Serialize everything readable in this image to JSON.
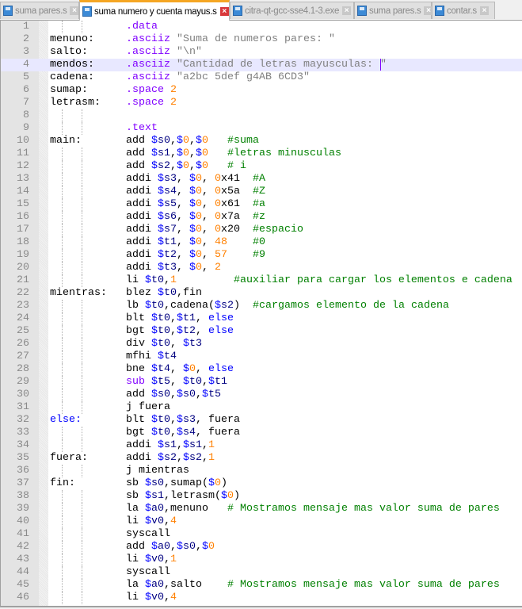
{
  "tabs": [
    {
      "label": "suma pares.s",
      "active": false
    },
    {
      "label": "suma numero y cuenta mayus.s",
      "active": true
    },
    {
      "label": "citra-qt-gcc-sse4.1-3.exe",
      "active": false
    },
    {
      "label": "suma pares.s",
      "active": false
    },
    {
      "label": "contar.s",
      "active": false
    }
  ],
  "current_line": 4,
  "caret_line": 4,
  "colors": {
    "accent": "#f5a623",
    "comment": "#008000",
    "number": "#ff8000",
    "directive": "#8000ff",
    "string": "#808080",
    "keyword": "#0000ff"
  },
  "lines": [
    {
      "n": "1",
      "label": "",
      "code": ".data"
    },
    {
      "n": "2",
      "label": "menuno:",
      "code": ".asciiz \"Suma de numeros pares: \""
    },
    {
      "n": "3",
      "label": "salto:",
      "code": ".asciiz \"\\n\""
    },
    {
      "n": "4",
      "label": "mendos:",
      "code": ".asciiz \"Cantidad de letras mayusculas: \""
    },
    {
      "n": "5",
      "label": "cadena:",
      "code": ".asciiz \"a2bc 5def g4AB 6CD3\""
    },
    {
      "n": "6",
      "label": "sumap:",
      "code": ".space 2"
    },
    {
      "n": "7",
      "label": "letrasm:",
      "code": ".space 2"
    },
    {
      "n": "8",
      "label": "",
      "code": ""
    },
    {
      "n": "9",
      "label": "",
      "code": ".text"
    },
    {
      "n": "10",
      "label": "main:",
      "code": "add $s0,$0,$0   #suma"
    },
    {
      "n": "11",
      "label": "",
      "code": "add $s1,$0,$0   #letras minusculas"
    },
    {
      "n": "12",
      "label": "",
      "code": "add $s2,$0,$0   # i"
    },
    {
      "n": "13",
      "label": "",
      "code": "addi $s3, $0, 0x41  #A"
    },
    {
      "n": "14",
      "label": "",
      "code": "addi $s4, $0, 0x5a  #Z"
    },
    {
      "n": "15",
      "label": "",
      "code": "addi $s5, $0, 0x61  #a"
    },
    {
      "n": "16",
      "label": "",
      "code": "addi $s6, $0, 0x7a  #z"
    },
    {
      "n": "17",
      "label": "",
      "code": "addi $s7, $0, 0x20  #espacio"
    },
    {
      "n": "18",
      "label": "",
      "code": "addi $t1, $0, 48    #0"
    },
    {
      "n": "19",
      "label": "",
      "code": "addi $t2, $0, 57    #9"
    },
    {
      "n": "20",
      "label": "",
      "code": "addi $t3, $0, 2"
    },
    {
      "n": "21",
      "label": "",
      "code": "li $t0,1         #auxiliar para cargar los elementos e cadena"
    },
    {
      "n": "22",
      "label": "mientras:",
      "code": "blez $t0,fin"
    },
    {
      "n": "23",
      "label": "",
      "code": "lb $t0,cadena($s2)  #cargamos elemento de la cadena"
    },
    {
      "n": "24",
      "label": "",
      "code": "blt $t0,$t1, else"
    },
    {
      "n": "25",
      "label": "",
      "code": "bgt $t0,$t2, else"
    },
    {
      "n": "26",
      "label": "",
      "code": "div $t0, $t3"
    },
    {
      "n": "27",
      "label": "",
      "code": "mfhi $t4"
    },
    {
      "n": "28",
      "label": "",
      "code": "bne $t4, $0, else"
    },
    {
      "n": "29",
      "label": "",
      "code": "sub $t5, $t0,$t1"
    },
    {
      "n": "30",
      "label": "",
      "code": "add $s0,$s0,$t5"
    },
    {
      "n": "31",
      "label": "",
      "code": "j fuera"
    },
    {
      "n": "32",
      "label": "else:",
      "code": "blt $t0,$s3, fuera"
    },
    {
      "n": "33",
      "label": "",
      "code": "bgt $t0,$s4, fuera"
    },
    {
      "n": "34",
      "label": "",
      "code": "addi $s1,$s1,1"
    },
    {
      "n": "35",
      "label": "fuera:",
      "code": "addi $s2,$s2,1"
    },
    {
      "n": "36",
      "label": "",
      "code": "j mientras"
    },
    {
      "n": "37",
      "label": "fin:",
      "code": "sb $s0,sumap($0)"
    },
    {
      "n": "38",
      "label": "",
      "code": "sb $s1,letrasm($0)"
    },
    {
      "n": "39",
      "label": "",
      "code": "la $a0,menuno   # Mostramos mensaje mas valor suma de pares"
    },
    {
      "n": "40",
      "label": "",
      "code": "li $v0,4"
    },
    {
      "n": "41",
      "label": "",
      "code": "syscall"
    },
    {
      "n": "42",
      "label": "",
      "code": "add $a0,$s0,$0"
    },
    {
      "n": "43",
      "label": "",
      "code": "li $v0,1"
    },
    {
      "n": "44",
      "label": "",
      "code": "syscall"
    },
    {
      "n": "45",
      "label": "",
      "code": "la $a0,salto    # Mostramos mensaje mas valor suma de pares"
    },
    {
      "n": "46",
      "label": "",
      "code": "li $v0,4"
    }
  ]
}
